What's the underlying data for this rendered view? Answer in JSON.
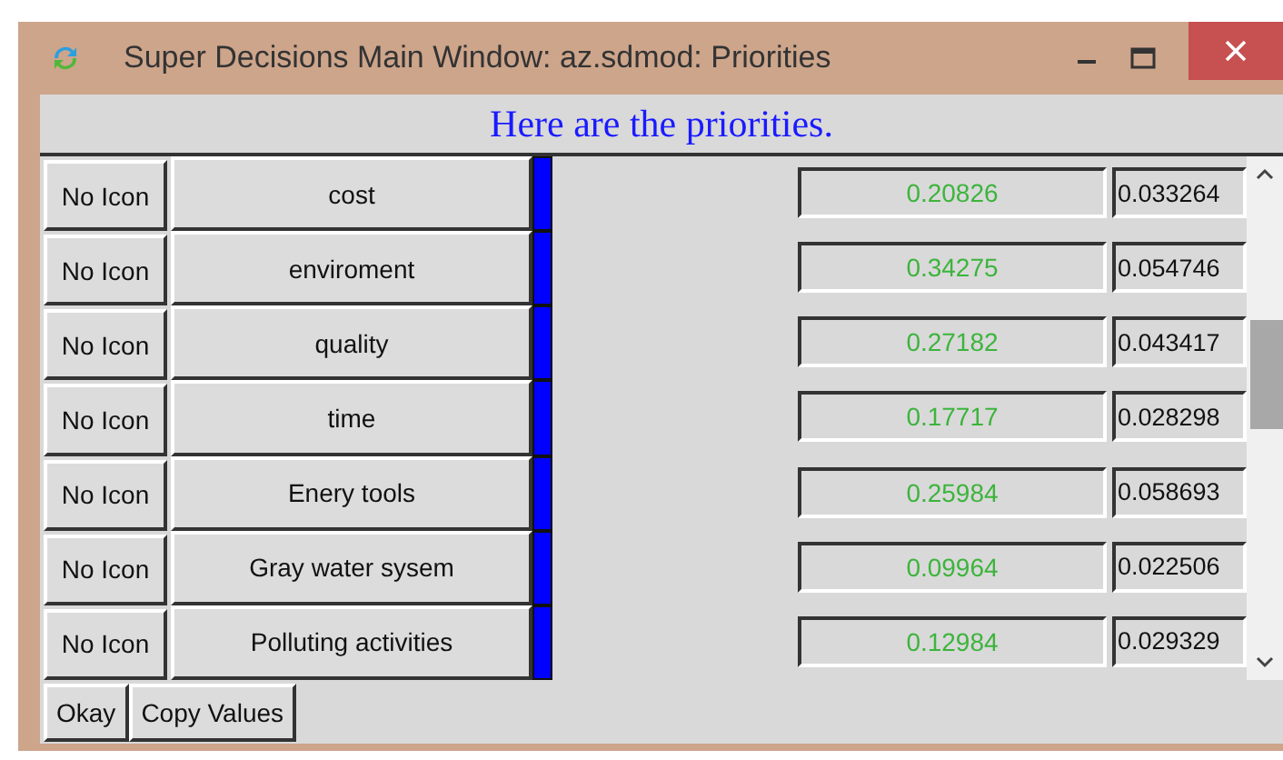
{
  "window": {
    "title": "Super Decisions Main Window: az.sdmod: Priorities"
  },
  "header": "Here are the priorities.",
  "rows": [
    {
      "icon_label": "No Icon",
      "name": "cost",
      "value": "0.20826",
      "normalized": "0.033264"
    },
    {
      "icon_label": "No Icon",
      "name": "enviroment",
      "value": "0.34275",
      "normalized": "0.054746"
    },
    {
      "icon_label": "No Icon",
      "name": "quality",
      "value": "0.27182",
      "normalized": "0.043417"
    },
    {
      "icon_label": "No Icon",
      "name": "time",
      "value": "0.17717",
      "normalized": "0.028298"
    },
    {
      "icon_label": "No Icon",
      "name": "Enery tools",
      "value": "0.25984",
      "normalized": "0.058693"
    },
    {
      "icon_label": "No Icon",
      "name": "Gray water sysem",
      "value": "0.09964",
      "normalized": "0.022506"
    },
    {
      "icon_label": "No Icon",
      "name": "Polluting activities",
      "value": "0.12984",
      "normalized": "0.029329"
    }
  ],
  "buttons": [
    "Okay",
    "Copy Values"
  ]
}
